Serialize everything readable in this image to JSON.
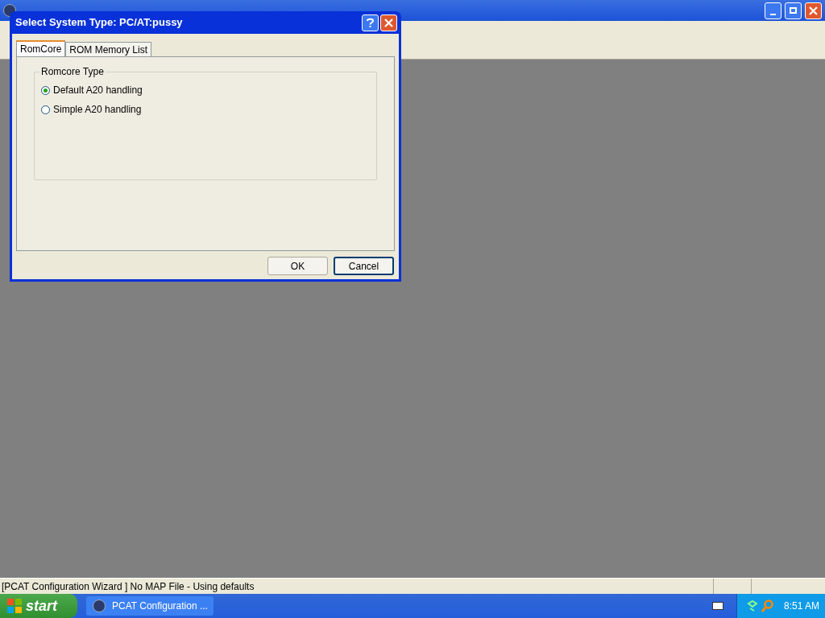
{
  "dialog": {
    "title": "Select System Type: PC/AT:pussy",
    "tabs": [
      {
        "label": "RomCore",
        "selected": true
      },
      {
        "label": "ROM Memory List",
        "selected": false
      }
    ],
    "group": {
      "title": "Romcore Type",
      "options": [
        {
          "label": "Default A20 handling",
          "selected": true
        },
        {
          "label": "Simple A20 handling",
          "selected": false
        }
      ]
    },
    "buttons": [
      {
        "label": "OK",
        "default": false
      },
      {
        "label": "Cancel",
        "default": true
      }
    ]
  },
  "status_bar": {
    "text": "[PCAT Configuration Wizard ] No MAP File - Using defaults"
  },
  "taskbar": {
    "start": "start",
    "tasks": [
      {
        "label": "PCAT Configuration ..."
      }
    ],
    "clock": "8:51 AM"
  }
}
